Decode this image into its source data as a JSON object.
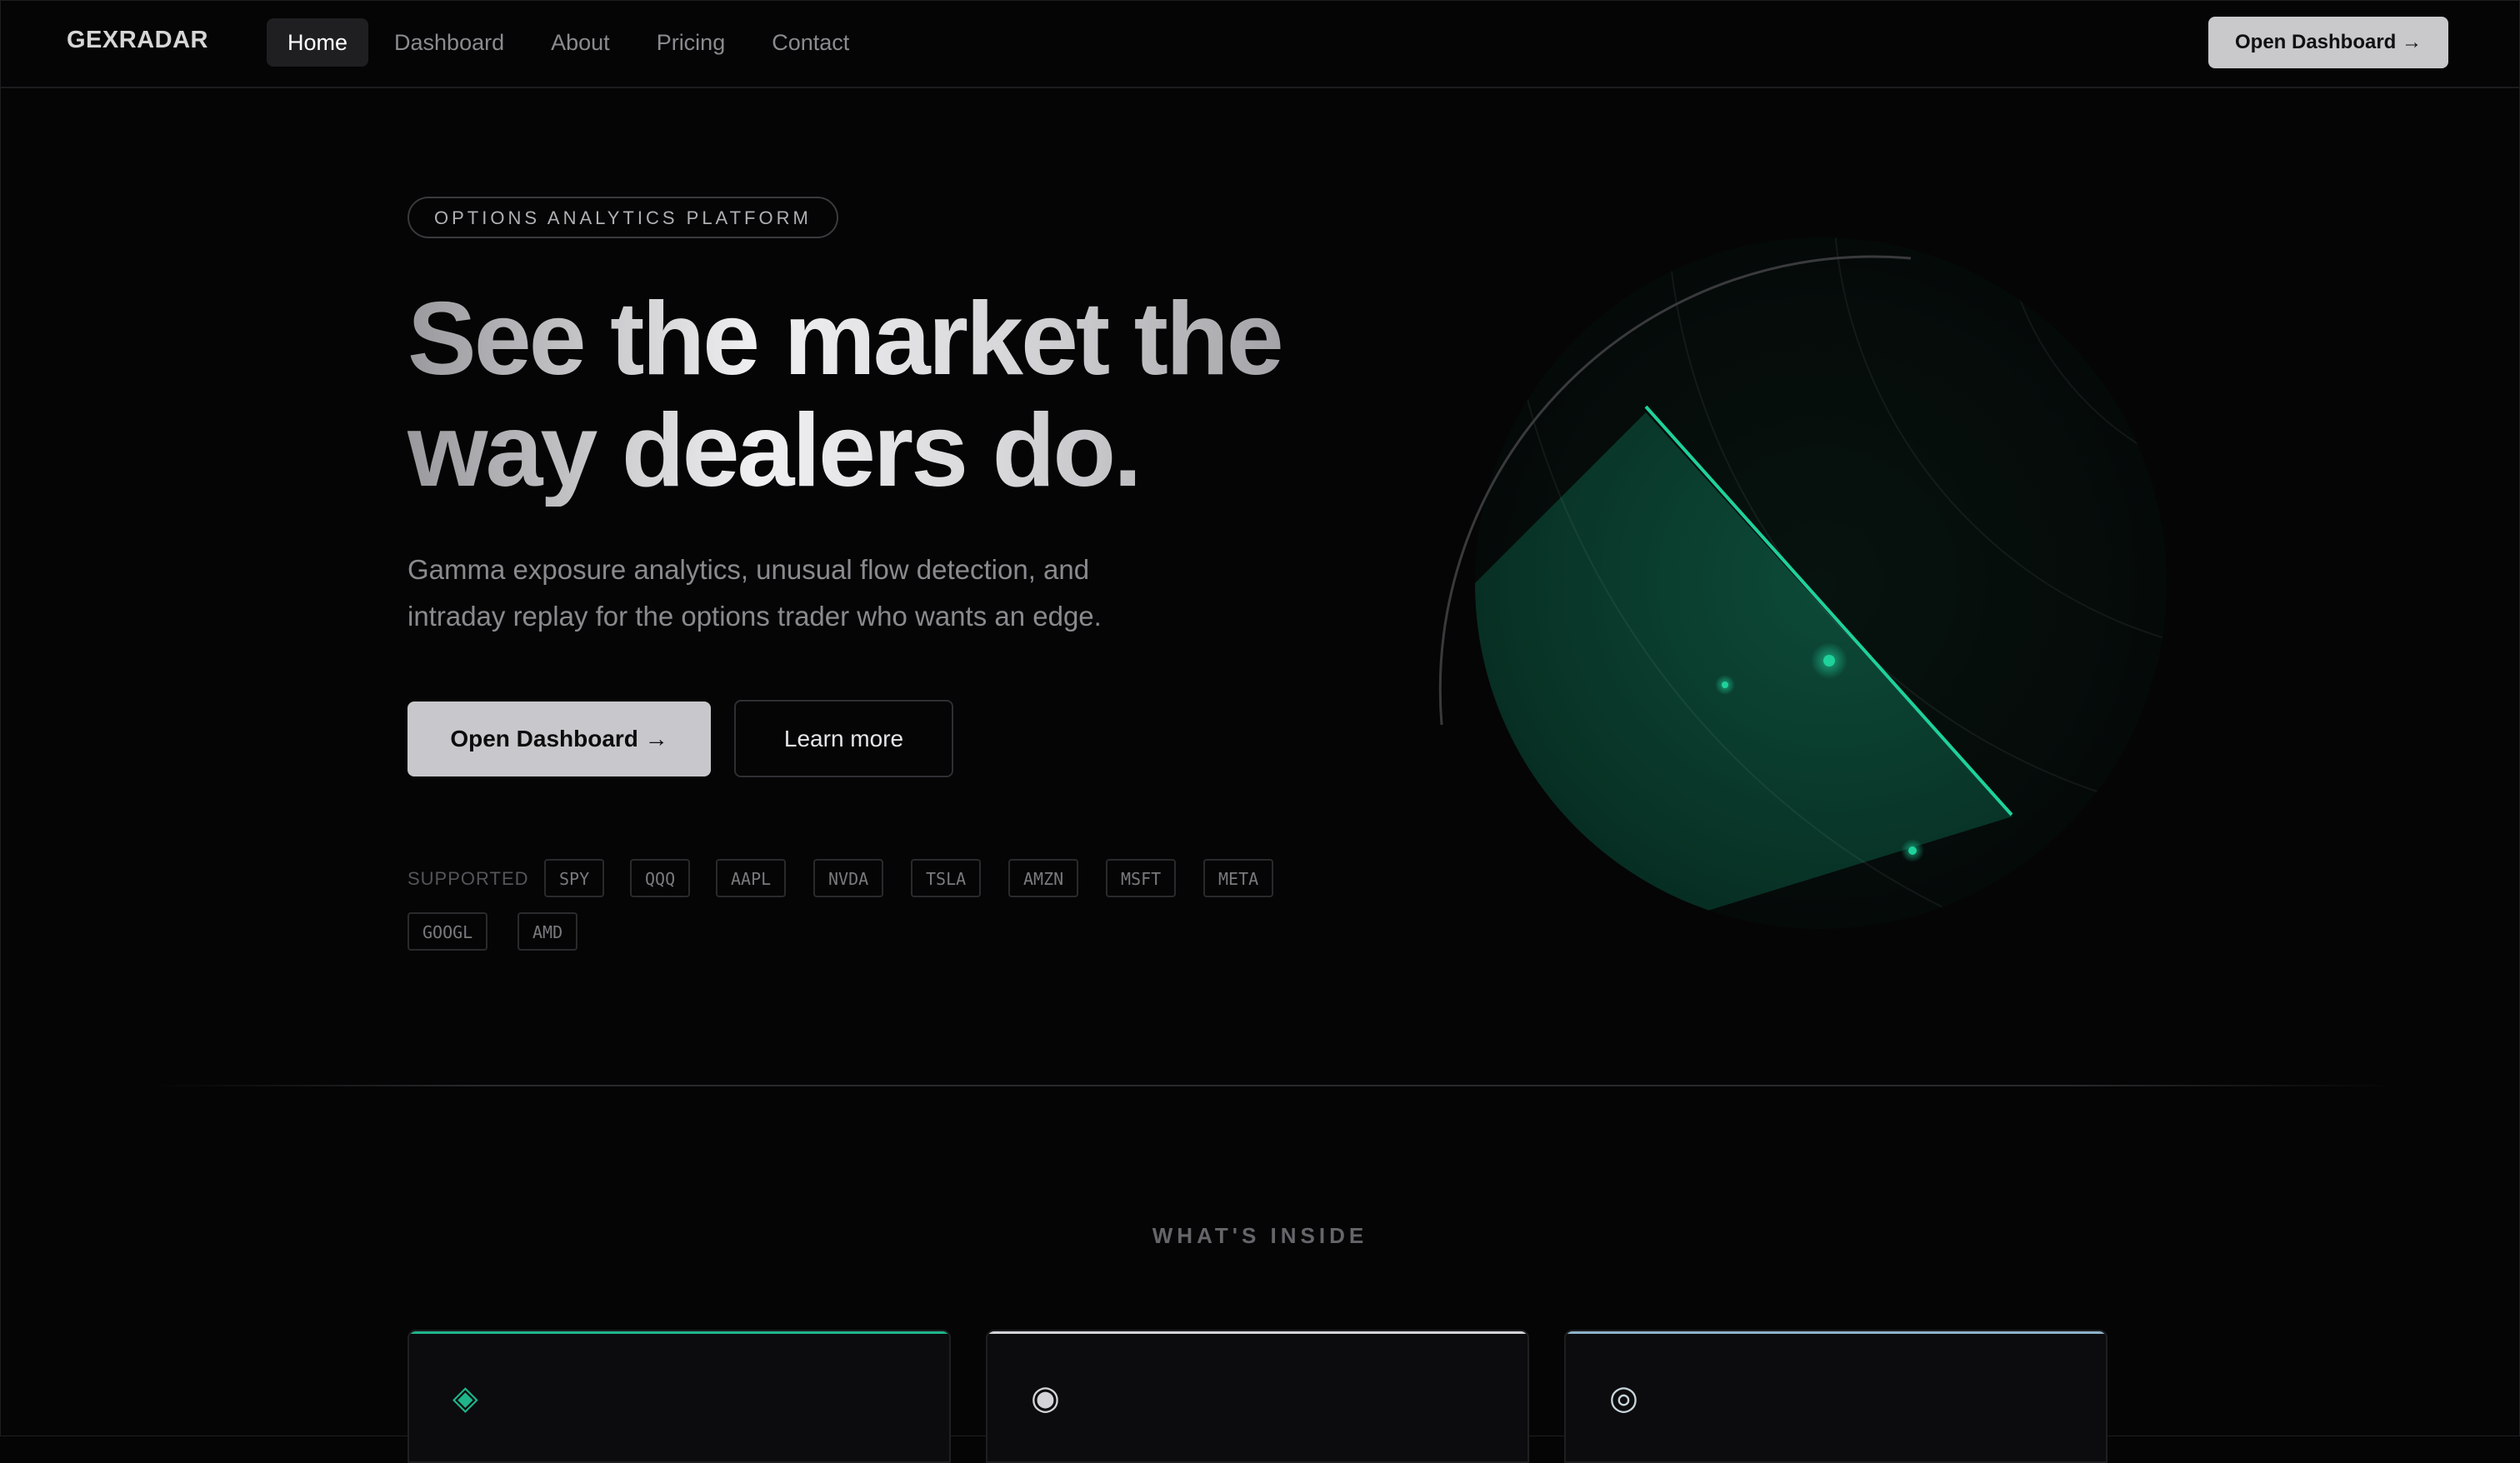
{
  "nav": {
    "logo": "GEXRADAR",
    "links": [
      "Home",
      "Dashboard",
      "About",
      "Pricing",
      "Contact"
    ],
    "cta": "Open Dashboard →"
  },
  "hero": {
    "eyebrow": "OPTIONS ANALYTICS PLATFORM",
    "title_line1": "See the market the",
    "title_line2": "way dealers do.",
    "subtitle_line1": "Gamma exposure analytics, unusual flow detection, and",
    "subtitle_line2": "intraday replay for the options trader who wants an edge.",
    "primary_cta": "Open Dashboard →",
    "secondary_cta": "Learn more",
    "supported_label": "SUPPORTED",
    "tickers": [
      "SPY",
      "QQQ",
      "AAPL",
      "NVDA",
      "TSLA",
      "AMZN",
      "MSFT",
      "META",
      "GOOGL",
      "AMD"
    ]
  },
  "section": {
    "label": "WHAT'S INSIDE",
    "cards": [
      {
        "icon": "◈",
        "icon_name": "diamond-icon",
        "accent": "#1fb58a"
      },
      {
        "icon": "◉",
        "icon_name": "target-dot-icon",
        "accent": "#d4d4d8"
      },
      {
        "icon": "◎",
        "icon_name": "bullseye-icon",
        "accent": "#8fb3c9"
      }
    ]
  },
  "colors": {
    "background": "#050506",
    "accent_green": "#1fd19b",
    "button_light": "#c8c8cc"
  }
}
